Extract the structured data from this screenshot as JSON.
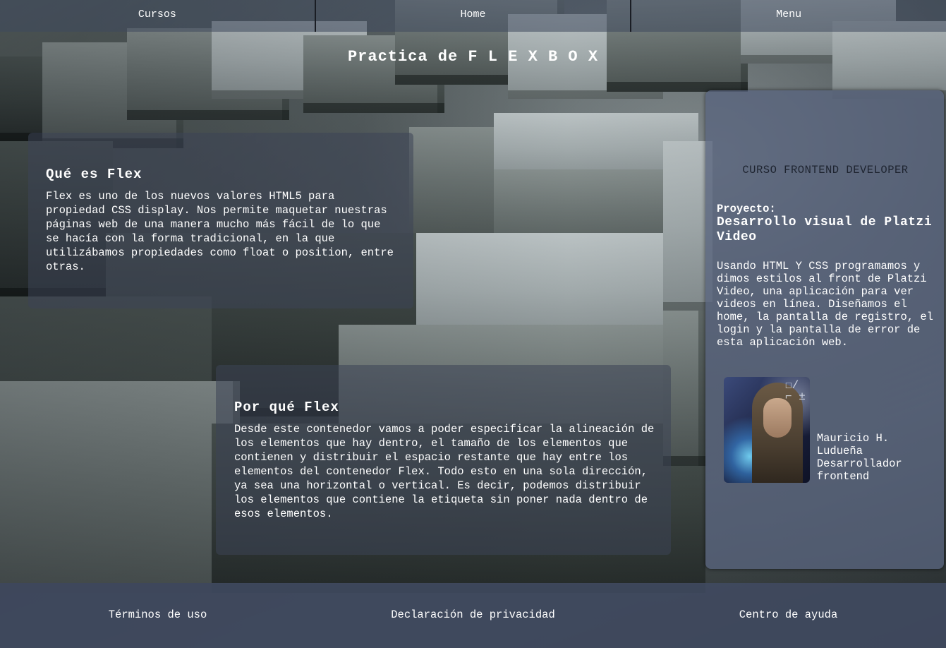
{
  "nav": {
    "items": [
      "Cursos",
      "Home",
      "Menu"
    ]
  },
  "page": {
    "title": "Practica de F L E X B O X"
  },
  "section_flex": {
    "title": "Qué es Flex",
    "text": "Flex es uno de los nuevos valores HTML5 para propiedad CSS display. Nos permite maquetar nuestras páginas web de una manera mucho más fácil de lo que se hacía con la forma tradicional, en la que utilizábamos propiedades como float o position, entre otras."
  },
  "section_why": {
    "title": "Por qué Flex",
    "text": "Desde este contenedor vamos a poder especificar la alineación de los elementos que hay dentro, el tamaño de los elementos que contienen y distribuir el espacio restante que hay entre los elementos del contenedor Flex. Todo esto en una sola dirección, ya sea una horizontal o vertical. Es decir, podemos distribuir los elementos que contiene la etiqueta sin poner nada dentro de esos elementos."
  },
  "aside": {
    "course": "CURSO FRONTEND DEVELOPER",
    "project_label": "Proyecto:",
    "project_name": "Desarrollo visual de Platzi Video",
    "description": "Usando HTML Y CSS programamos y dimos estilos al front de Platzi Video, una aplicación para ver videos en línea. Diseñamos el home, la pantalla de registro, el login y la pantalla de error de esta aplicación web.",
    "author": {
      "name": "Mauricio H. Ludueña",
      "role": "Desarrollador frontend",
      "avatar_icon": "author-photo"
    }
  },
  "footer": {
    "links": [
      "Términos de uso",
      "Declaración de privacidad",
      "Centro de ayuda"
    ]
  },
  "colors": {
    "nav_bg": "#3e485c",
    "card_bg": "#3c4456",
    "aside_bg": "#58647e",
    "footer_bg": "#404a60",
    "course_title": "#1e2430"
  }
}
